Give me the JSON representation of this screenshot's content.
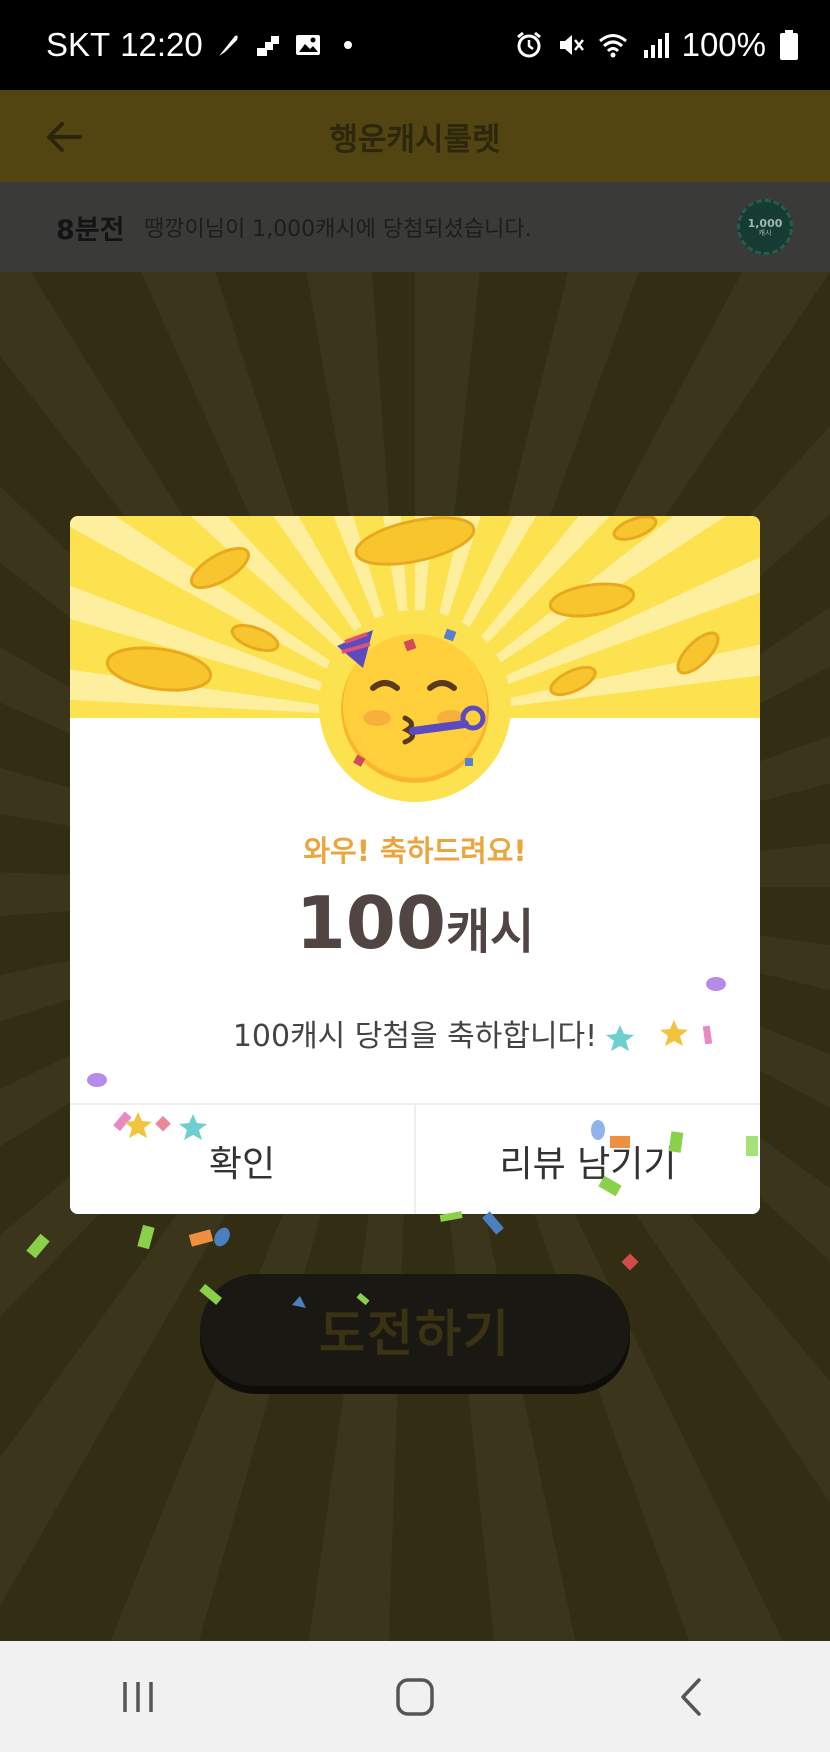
{
  "status_bar": {
    "carrier": "SKT",
    "time": "12:20",
    "battery": "100%",
    "left_icons": [
      "feather-icon",
      "steps-icon",
      "image-icon",
      "dot-icon"
    ],
    "right_icons": [
      "alarm-icon",
      "mute-icon",
      "wifi-icon",
      "signal-icon",
      "battery-icon"
    ]
  },
  "header": {
    "title": "행운캐시룰렛"
  },
  "winner_bar": {
    "time_ago": "8분전",
    "message": "땡깡이님이 1,000캐시에 당첨되셨습니다.",
    "badge_value": "1,000",
    "badge_unit": "캐시"
  },
  "dialog": {
    "congrats": "와우! 축하드려요!",
    "amount_number": "100",
    "amount_unit": "캐시",
    "message": "100캐시 당첨을 축하합니다!",
    "confirm_label": "확인",
    "review_label": "리뷰 남기기"
  },
  "main": {
    "challenge_label": "도전하기"
  },
  "nav": {
    "icons": [
      "recents-icon",
      "home-icon",
      "back-icon"
    ]
  },
  "colors": {
    "dialog_banner": "#fbe24e",
    "congrats_text": "#eba53f",
    "amount_text": "#514543",
    "app_background": "#332e13"
  }
}
